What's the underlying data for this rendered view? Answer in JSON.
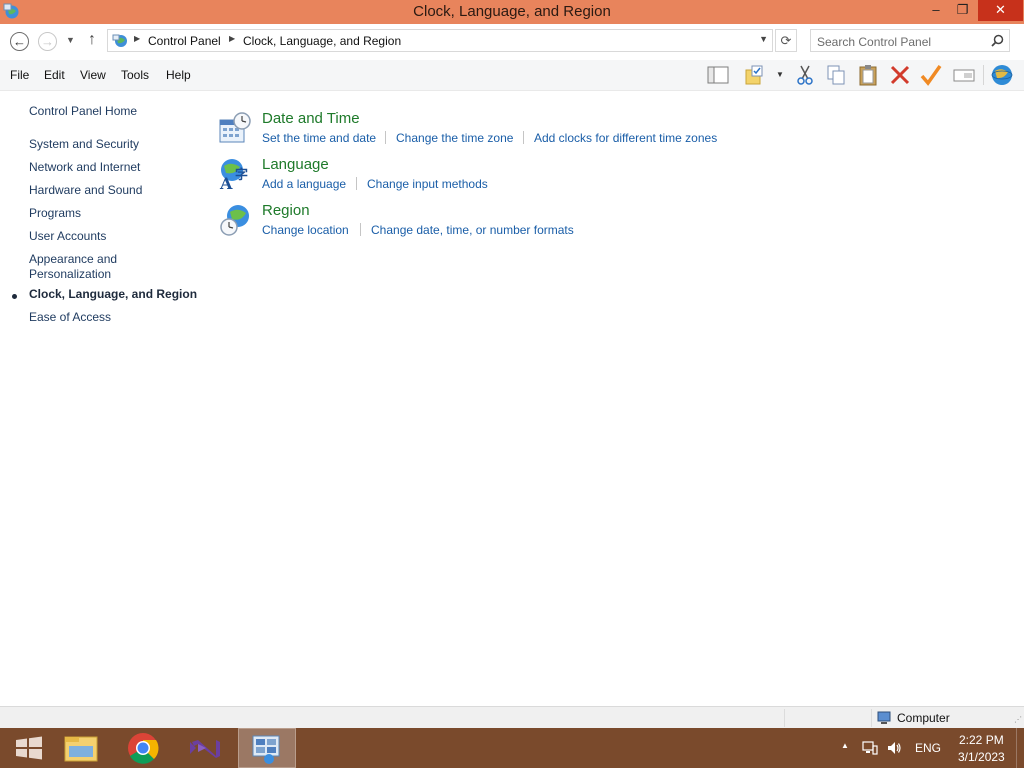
{
  "window": {
    "title": "Clock, Language, and Region",
    "controls": {
      "minimize": "–",
      "maximize": "❐",
      "close": "✕"
    }
  },
  "address": {
    "crumbs": [
      "Control Panel",
      "Clock, Language, and Region"
    ]
  },
  "search": {
    "placeholder": "Search Control Panel"
  },
  "menu": [
    "File",
    "Edit",
    "View",
    "Tools",
    "Help"
  ],
  "toolbar_icons": [
    "layout-icon",
    "folder-options-icon",
    "cut-icon",
    "copy-icon",
    "paste-icon",
    "delete-icon",
    "checkmark-icon",
    "rename-icon",
    "globe-icon"
  ],
  "sidebar": {
    "home": "Control Panel Home",
    "items": [
      "System and Security",
      "Network and Internet",
      "Hardware and Sound",
      "Programs",
      "User Accounts",
      "Appearance and Personalization",
      "Clock, Language, and Region",
      "Ease of Access"
    ],
    "current": "Clock, Language, and Region"
  },
  "categories": [
    {
      "title": "Date and Time",
      "icon": "calendar-clock-icon",
      "tasks": [
        "Set the time and date",
        "Change the time zone",
        "Add clocks for different time zones"
      ]
    },
    {
      "title": "Language",
      "icon": "language-icon",
      "tasks": [
        "Add a language",
        "Change input methods"
      ]
    },
    {
      "title": "Region",
      "icon": "globe-clock-icon",
      "tasks": [
        "Change location",
        "Change date, time, or number formats"
      ]
    }
  ],
  "statusbar": {
    "text": "Computer"
  },
  "taskbar": {
    "apps": [
      "start-icon",
      "file-explorer-icon",
      "chrome-icon",
      "visual-studio-icon",
      "control-panel-icon"
    ],
    "tray": {
      "language": "ENG",
      "time": "2:22 PM",
      "date": "3/1/2023"
    }
  },
  "colors": {
    "titlebar": "#e8845c",
    "close_button": "#c7311b",
    "category_title": "#1e7a2a",
    "link": "#1a5ea8",
    "taskbar": "#7a4a2c"
  }
}
